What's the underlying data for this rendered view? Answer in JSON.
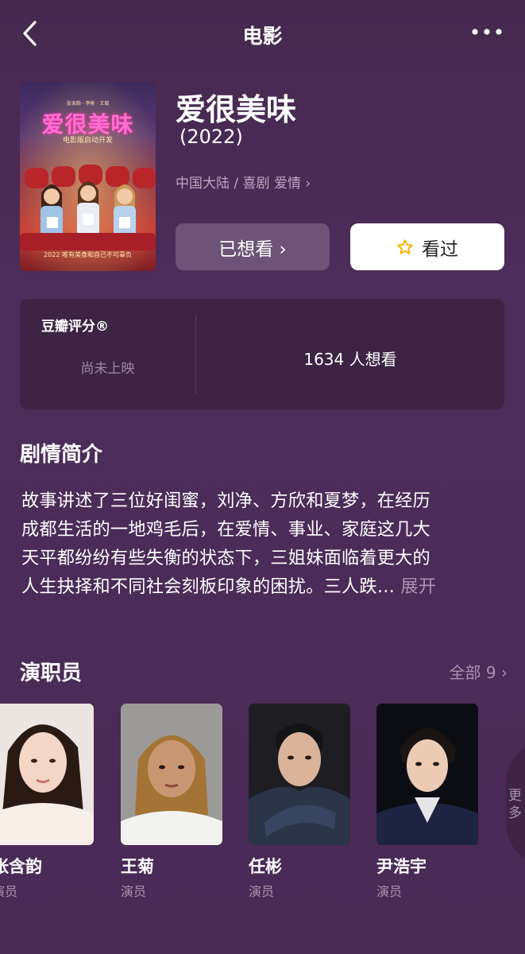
{
  "nav": {
    "title": "电影"
  },
  "movie": {
    "title": "爱很美味",
    "year": "(2022)",
    "meta": "中国大陆 / 喜剧 爱情 ›",
    "want_button": "已想看 ›",
    "seen_button": "看过"
  },
  "poster": {
    "top_credits": "张含韵 · 李彬 · 王菊",
    "title": "爱很美味",
    "subtitle": "电影版启动开发",
    "tagline": "2022 唯有美食和自己不可辜负"
  },
  "rating": {
    "label": "豆瓣评分®",
    "status": "尚未上映",
    "want_count": "1634 人想看"
  },
  "synopsis": {
    "title": "剧情简介",
    "lines": [
      "故事讲述了三位好闺蜜，刘净、方欣和夏梦，在经历",
      "成都生活的一地鸡毛后，在爱情、事业、家庭这几大",
      "天平都纷纷有些失衡的状态下，三姐妹面临着更大的",
      "人生抉择和不同社会刻板印象的困扰。三人跌…"
    ],
    "expand": "展开"
  },
  "cast": {
    "title": "演职员",
    "all": "全部 9 ›",
    "members": [
      {
        "name": "张含韵",
        "role": "演员"
      },
      {
        "name": "王菊",
        "role": "演员"
      },
      {
        "name": "任彬",
        "role": "演员"
      },
      {
        "name": "尹浩宇",
        "role": "演员"
      }
    ],
    "more": "更多"
  },
  "colors": {
    "background": "#4a2c56",
    "card": "#3d2445",
    "muted_text": "#a792b0",
    "want_button_bg": "#6c5377",
    "star": "#f5b400"
  }
}
